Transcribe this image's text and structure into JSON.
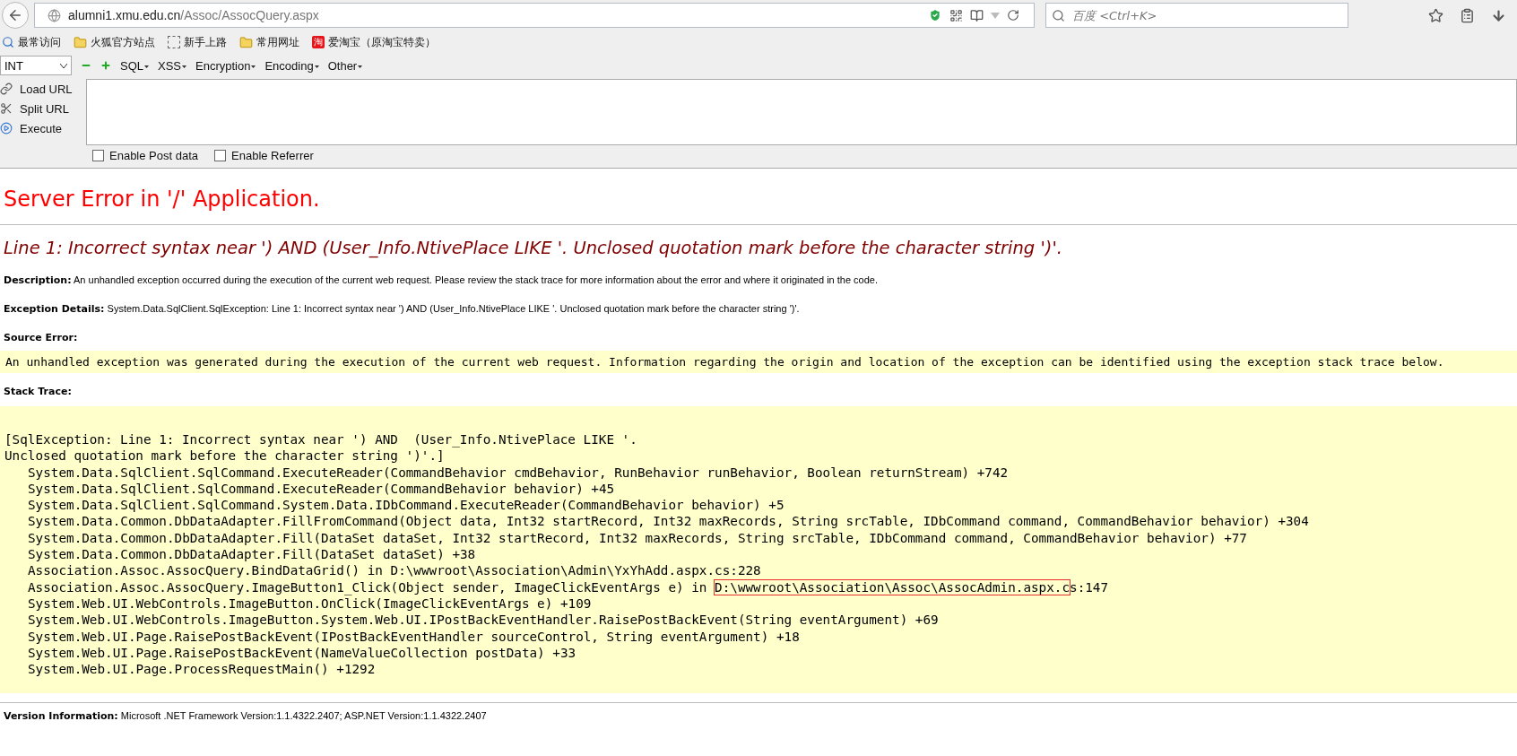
{
  "browser": {
    "url_host": "alumni1.xmu.edu.cn",
    "url_path": "/Assoc/AssocQuery.aspx",
    "search_placeholder": "百度 <Ctrl+K>"
  },
  "bookmarks": [
    {
      "label": "最常访问",
      "kind": "smart"
    },
    {
      "label": "火狐官方站点",
      "kind": "folder"
    },
    {
      "label": "新手上路",
      "kind": "page"
    },
    {
      "label": "常用网址",
      "kind": "folder"
    },
    {
      "label": "爱淘宝（原淘宝特卖）",
      "kind": "shop",
      "badge": "淘"
    }
  ],
  "hackbar": {
    "select": "INT",
    "menus": [
      "SQL",
      "XSS",
      "Encryption",
      "Encoding",
      "Other"
    ],
    "actions": [
      {
        "label": "Load URL",
        "kind": "load"
      },
      {
        "label": "Split URL",
        "kind": "split"
      },
      {
        "label": "Execute",
        "kind": "execute"
      }
    ],
    "checkboxes": [
      {
        "label": "Enable Post data",
        "checked": false
      },
      {
        "label": "Enable Referrer",
        "checked": false
      }
    ]
  },
  "page": {
    "title": "Server Error in '/' Application.",
    "message": "Line 1: Incorrect syntax near ') AND (User_Info.NtivePlace LIKE '. Unclosed quotation mark before the character string ')'.",
    "details": [
      {
        "label": "Description:",
        "text": "An unhandled exception occurred during the execution of the current web request. Please review the stack trace for more information about the error and where it originated in the code."
      },
      {
        "label": "Exception Details:",
        "text": "System.Data.SqlClient.SqlException: Line 1: Incorrect syntax near ') AND (User_Info.NtivePlace LIKE '. Unclosed quotation mark before the character string ')'."
      }
    ],
    "source_error_label": "Source Error:",
    "source_error_text": "An unhandled exception was generated during the execution of the current web request. Information regarding the origin and location of the exception can be identified using the exception stack trace below.",
    "stack_trace_label": "Stack Trace:",
    "stack_header": [
      "[SqlException: Line 1: Incorrect syntax near ') AND  (User_Info.NtivePlace LIKE '.",
      "Unclosed quotation mark before the character string ')'.]"
    ],
    "stack_frames": [
      {
        "text": "System.Data.SqlClient.SqlCommand.ExecuteReader(CommandBehavior cmdBehavior, RunBehavior runBehavior, Boolean returnStream) +742"
      },
      {
        "text": "System.Data.SqlClient.SqlCommand.ExecuteReader(CommandBehavior behavior) +45"
      },
      {
        "text": "System.Data.SqlClient.SqlCommand.System.Data.IDbCommand.ExecuteReader(CommandBehavior behavior) +5"
      },
      {
        "text": "System.Data.Common.DbDataAdapter.FillFromCommand(Object data, Int32 startRecord, Int32 maxRecords, String srcTable, IDbCommand command, CommandBehavior behavior) +304"
      },
      {
        "text": "System.Data.Common.DbDataAdapter.Fill(DataSet dataSet, Int32 startRecord, Int32 maxRecords, String srcTable, IDbCommand command, CommandBehavior behavior) +77"
      },
      {
        "text": "System.Data.Common.DbDataAdapter.Fill(DataSet dataSet) +38"
      },
      {
        "text": "Association.Assoc.AssocQuery.BindDataGrid() in D:\\wwwroot\\Association\\Admin\\YxYhAdd.aspx.cs:228"
      },
      {
        "text": "Association.Assoc.AssocQuery.ImageButton1_Click(Object sender, ImageClickEventArgs e) in ",
        "boxed": "D:\\wwwroot\\Association\\Assoc\\AssocAdmin.aspx.c",
        "after": "s:147"
      },
      {
        "text": "System.Web.UI.WebControls.ImageButton.OnClick(ImageClickEventArgs e) +109"
      },
      {
        "text": "System.Web.UI.WebControls.ImageButton.System.Web.UI.IPostBackEventHandler.RaisePostBackEvent(String eventArgument) +69"
      },
      {
        "text": "System.Web.UI.Page.RaisePostBackEvent(IPostBackEventHandler sourceControl, String eventArgument) +18"
      },
      {
        "text": "System.Web.UI.Page.RaisePostBackEvent(NameValueCollection postData) +33"
      },
      {
        "text": "System.Web.UI.Page.ProcessRequestMain() +1292"
      }
    ],
    "version": {
      "label": "Version Information:",
      "text": "Microsoft .NET Framework Version:1.1.4322.2407; ASP.NET Version:1.1.4322.2407"
    }
  }
}
